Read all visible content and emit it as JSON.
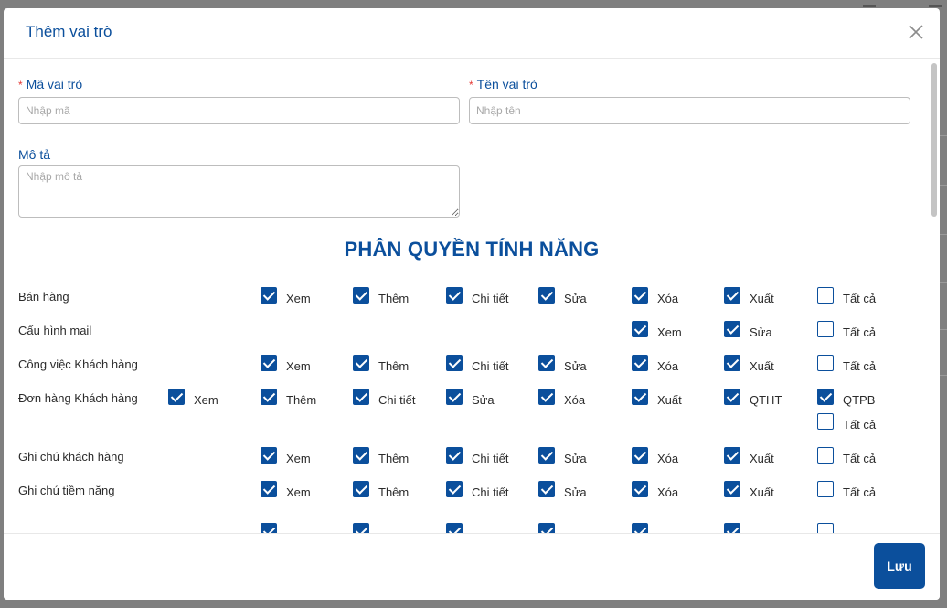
{
  "dialog": {
    "title": "Thêm vai trò",
    "save_label": "Lưu"
  },
  "form": {
    "code": {
      "label": "Mã vai trò",
      "placeholder": "Nhập mã",
      "value": ""
    },
    "name": {
      "label": "Tên vai trò",
      "placeholder": "Nhập tên",
      "value": ""
    },
    "desc": {
      "label": "Mô tả",
      "placeholder": "Nhập mô tả",
      "value": ""
    },
    "required_mark": "*"
  },
  "permissions": {
    "section_title": "PHÂN QUYỀN TÍNH NĂNG",
    "rows": [
      {
        "label": "Bán hàng",
        "perms": [
          {
            "label": "Xem",
            "checked": true
          },
          {
            "label": "Thêm",
            "checked": true
          },
          {
            "label": "Chi tiết",
            "checked": true
          },
          {
            "label": "Sửa",
            "checked": true
          },
          {
            "label": "Xóa",
            "checked": true
          },
          {
            "label": "Xuất",
            "checked": true
          },
          {
            "label": "Tất cả",
            "checked": false
          }
        ]
      },
      {
        "label": "Cấu hình mail",
        "perms": [
          {
            "label": "Xem",
            "checked": true
          },
          {
            "label": "Sửa",
            "checked": true
          },
          {
            "label": "Tất cả",
            "checked": false
          }
        ]
      },
      {
        "label": "Công việc Khách hàng",
        "perms": [
          {
            "label": "Xem",
            "checked": true
          },
          {
            "label": "Thêm",
            "checked": true
          },
          {
            "label": "Chi tiết",
            "checked": true
          },
          {
            "label": "Sửa",
            "checked": true
          },
          {
            "label": "Xóa",
            "checked": true
          },
          {
            "label": "Xuất",
            "checked": true
          },
          {
            "label": "Tất cả",
            "checked": false
          }
        ]
      },
      {
        "label": "Đơn hàng Khách hàng",
        "perms": [
          {
            "label": "Xem",
            "checked": true
          },
          {
            "label": "Thêm",
            "checked": true
          },
          {
            "label": "Chi tiết",
            "checked": true
          },
          {
            "label": "Sửa",
            "checked": true
          },
          {
            "label": "Xóa",
            "checked": true
          },
          {
            "label": "Xuất",
            "checked": true
          },
          {
            "label": "QTHT",
            "checked": true
          },
          {
            "label": "QTPB",
            "checked": true
          },
          {
            "label": "Tất cả",
            "checked": false
          }
        ]
      },
      {
        "label": "Ghi chú khách hàng",
        "perms": [
          {
            "label": "Xem",
            "checked": true
          },
          {
            "label": "Thêm",
            "checked": true
          },
          {
            "label": "Chi tiết",
            "checked": true
          },
          {
            "label": "Sửa",
            "checked": true
          },
          {
            "label": "Xóa",
            "checked": true
          },
          {
            "label": "Xuất",
            "checked": true
          },
          {
            "label": "Tất cả",
            "checked": false
          }
        ]
      },
      {
        "label": "Ghi chú tiềm năng",
        "perms": [
          {
            "label": "Xem",
            "checked": true
          },
          {
            "label": "Thêm",
            "checked": true
          },
          {
            "label": "Chi tiết",
            "checked": true
          },
          {
            "label": "Sửa",
            "checked": true
          },
          {
            "label": "Xóa",
            "checked": true
          },
          {
            "label": "Xuất",
            "checked": true
          },
          {
            "label": "Tất cả",
            "checked": false
          }
        ]
      }
    ],
    "partial_row_checked": [
      true,
      true,
      true,
      true,
      true,
      true,
      false
    ]
  },
  "colors": {
    "accent": "#0b4f9c",
    "required": "#e53935",
    "overlay": "#7f7f7f"
  },
  "icons": {
    "close": "close-icon",
    "check": "checkmark-icon"
  }
}
